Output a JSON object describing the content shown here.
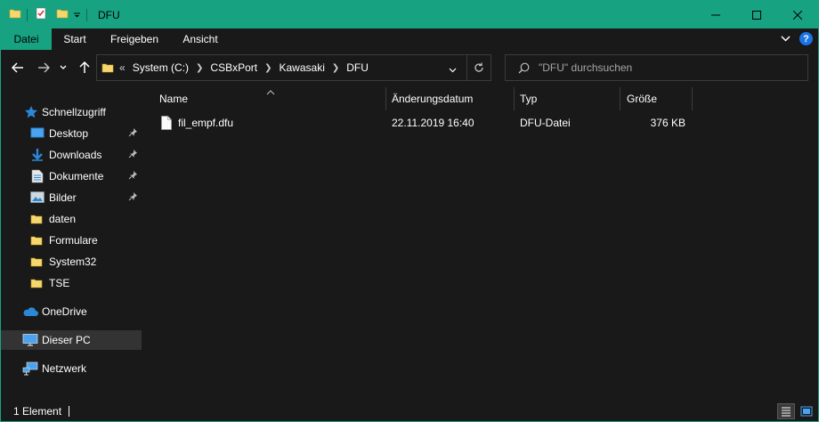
{
  "window": {
    "title": "DFU",
    "accent_color": "#17a281"
  },
  "ribbon": {
    "tabs": [
      {
        "label": "Datei",
        "active": true
      },
      {
        "label": "Start",
        "active": false
      },
      {
        "label": "Freigeben",
        "active": false
      },
      {
        "label": "Ansicht",
        "active": false
      }
    ]
  },
  "address": {
    "overflow": "«",
    "crumbs": [
      "System (C:)",
      "CSBxPort",
      "Kawasaki",
      "DFU"
    ]
  },
  "search": {
    "placeholder": "\"DFU\" durchsuchen"
  },
  "sidebar": {
    "quick_access": "Schnellzugriff",
    "items": [
      {
        "label": "Desktop",
        "icon": "desktop-icon",
        "pinned": true
      },
      {
        "label": "Downloads",
        "icon": "download-icon",
        "pinned": true
      },
      {
        "label": "Dokumente",
        "icon": "documents-icon",
        "pinned": true
      },
      {
        "label": "Bilder",
        "icon": "pictures-icon",
        "pinned": true
      },
      {
        "label": "daten",
        "icon": "folder-icon",
        "pinned": false
      },
      {
        "label": "Formulare",
        "icon": "folder-icon",
        "pinned": false
      },
      {
        "label": "System32",
        "icon": "folder-icon",
        "pinned": false
      },
      {
        "label": "TSE",
        "icon": "folder-icon",
        "pinned": false
      }
    ],
    "onedrive": "OneDrive",
    "this_pc": "Dieser PC",
    "network": "Netzwerk"
  },
  "columns": {
    "name": "Name",
    "date": "Änderungsdatum",
    "type": "Typ",
    "size": "Größe"
  },
  "files": [
    {
      "name": "fil_empf.dfu",
      "date": "22.11.2019 16:40",
      "type": "DFU-Datei",
      "size": "376 KB"
    }
  ],
  "status": {
    "count": "1 Element"
  }
}
